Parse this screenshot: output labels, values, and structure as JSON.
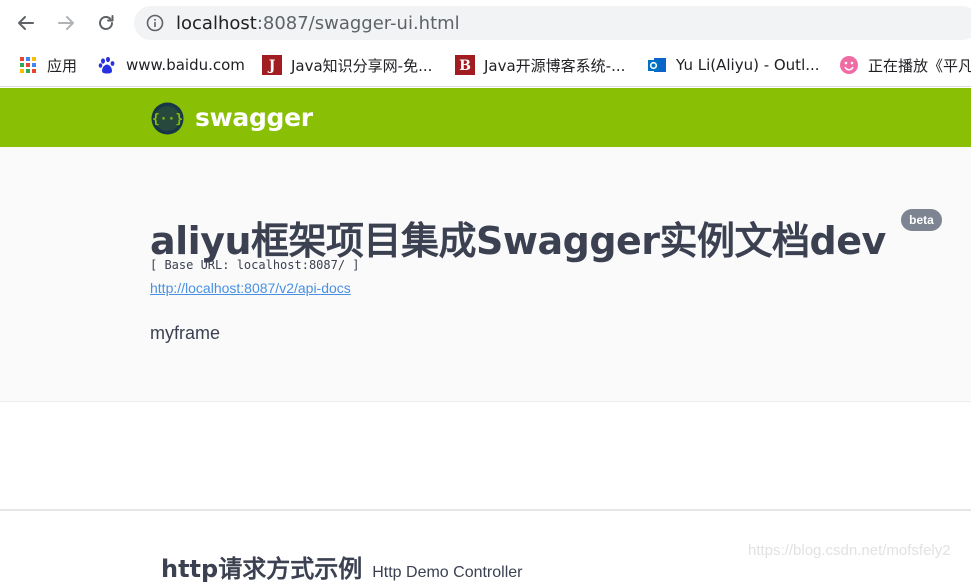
{
  "browser": {
    "url_host": "localhost",
    "url_path": ":8087/swagger-ui.html",
    "back_icon": "arrow-left-icon",
    "forward_icon": "arrow-right-icon",
    "reload_icon": "reload-icon",
    "info_icon": "info-circle-icon"
  },
  "bookmarks": [
    {
      "label": "应用",
      "icon": "apps-grid-icon"
    },
    {
      "label": "www.baidu.com",
      "icon": "baidu-paw-icon"
    },
    {
      "label": "Java知识分享网-免...",
      "icon": "letter-j-icon"
    },
    {
      "label": "Java开源博客系统-...",
      "icon": "letter-b-icon"
    },
    {
      "label": "Yu Li(Aliyu) - Outl...",
      "icon": "outlook-icon"
    },
    {
      "label": "正在播放《平凡",
      "icon": "smiley-icon"
    }
  ],
  "swagger": {
    "brand": "swagger",
    "header_color": "#89bf04"
  },
  "info": {
    "title": "aliyu框架项目集成Swagger实例文档dev",
    "badge": "beta",
    "base_url": "[ Base URL: localhost:8087/ ]",
    "api_docs_link": "http://localhost:8087/v2/api-docs",
    "description": "myframe"
  },
  "tag": {
    "name": "http请求方式示例",
    "description": "Http Demo Controller"
  },
  "watermark": "https://blog.csdn.net/mofsfely2"
}
